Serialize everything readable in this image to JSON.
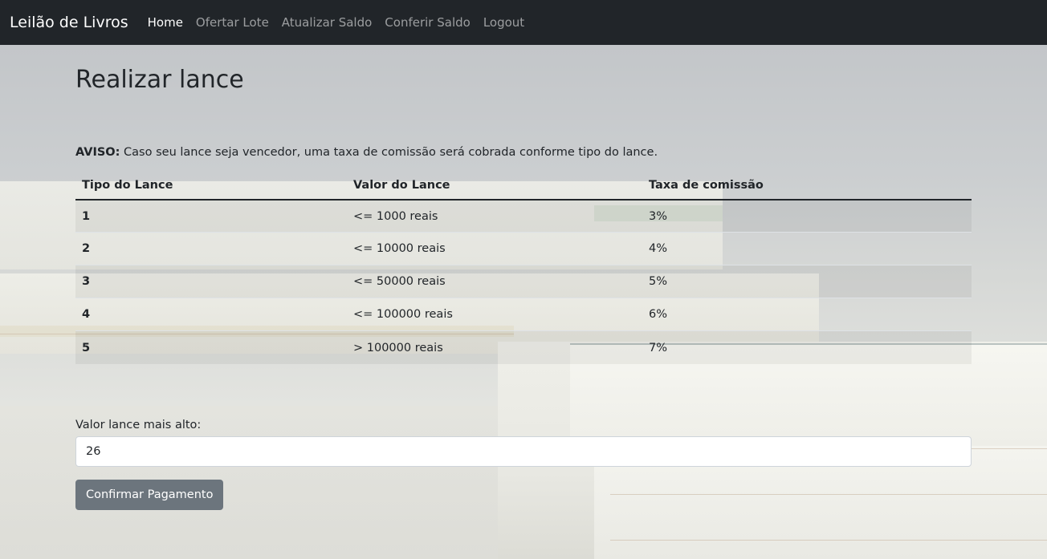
{
  "navbar": {
    "brand": "Leilão de Livros",
    "links": [
      "Home",
      "Ofertar Lote",
      "Atualizar Saldo",
      "Conferir Saldo",
      "Logout"
    ]
  },
  "page": {
    "title": "Realizar lance",
    "notice_label": "AVISO:",
    "notice_text": " Caso seu lance seja vencedor, uma taxa de comissão será cobrada conforme tipo do lance."
  },
  "table": {
    "headers": [
      "Tipo do Lance",
      "Valor do Lance",
      "Taxa de comissão"
    ],
    "rows": [
      [
        "1",
        "<= 1000 reais",
        "3%"
      ],
      [
        "2",
        "<= 10000 reais",
        "4%"
      ],
      [
        "3",
        "<= 50000 reais",
        "5%"
      ],
      [
        "4",
        "<= 100000 reais",
        "6%"
      ],
      [
        "5",
        "> 100000 reais",
        "7%"
      ]
    ]
  },
  "form": {
    "label": "Valor lance mais alto:",
    "value": "26",
    "submit_label": "Confirmar Pagamento"
  },
  "colors": {
    "navbar_bg": "#212529",
    "button_bg": "#6c757d"
  }
}
